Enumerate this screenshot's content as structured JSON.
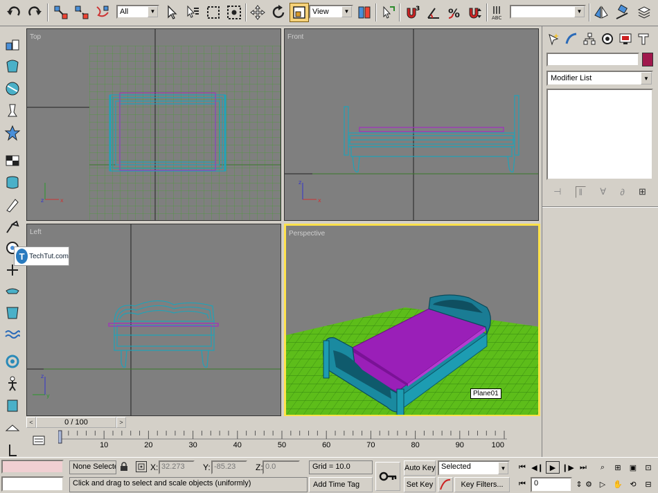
{
  "toolbar": {
    "selection_filter": "All",
    "reference_coord": "View",
    "named_selection": "",
    "icons": [
      "undo-icon",
      "redo-icon",
      "select-and-link-icon",
      "unlink-icon",
      "bind-space-warp-icon",
      "select-object-icon",
      "select-by-name-icon",
      "rectangular-selection-icon",
      "window-crossing-icon",
      "move-icon",
      "rotate-icon",
      "scale-icon",
      "pivot-center-icon",
      "select-manipulate-icon",
      "snap-3d-icon",
      "angle-snap-icon",
      "percent-snap-icon",
      "spinner-snap-icon",
      "edit-named-selections-icon",
      "mirror-icon",
      "align-icon",
      "layer-manager-icon"
    ]
  },
  "viewports": {
    "top": {
      "label": "Top"
    },
    "front": {
      "label": "Front"
    },
    "left": {
      "label": "Left"
    },
    "perspective": {
      "label": "Perspective",
      "tooltip": "Plane01"
    }
  },
  "watermark": {
    "brand": "TechTut.com",
    "logo_letter": "T"
  },
  "command_panel": {
    "object_name": "",
    "object_color": "#a0184c",
    "modifier_list": "Modifier List"
  },
  "timeslider": {
    "position_label": "0 / 100",
    "prev": "<",
    "next": ">",
    "ticks": [
      0,
      10,
      20,
      30,
      40,
      50,
      60,
      70,
      80,
      90,
      100
    ]
  },
  "status": {
    "selection_info": "None Selecte",
    "x_label": "X:",
    "x_value": "32.273",
    "y_label": "Y:",
    "y_value": "-85.23",
    "z_label": "Z:",
    "z_value": "0.0",
    "grid": "Grid = 10.0",
    "add_time_tag": "Add Time Tag",
    "prompt": "Click and drag to select and scale objects (uniformly)",
    "auto_key": "Auto Key",
    "set_key": "Set Key",
    "key_mode": "Selected",
    "key_filters": "Key Filters...",
    "current_frame": "0"
  }
}
